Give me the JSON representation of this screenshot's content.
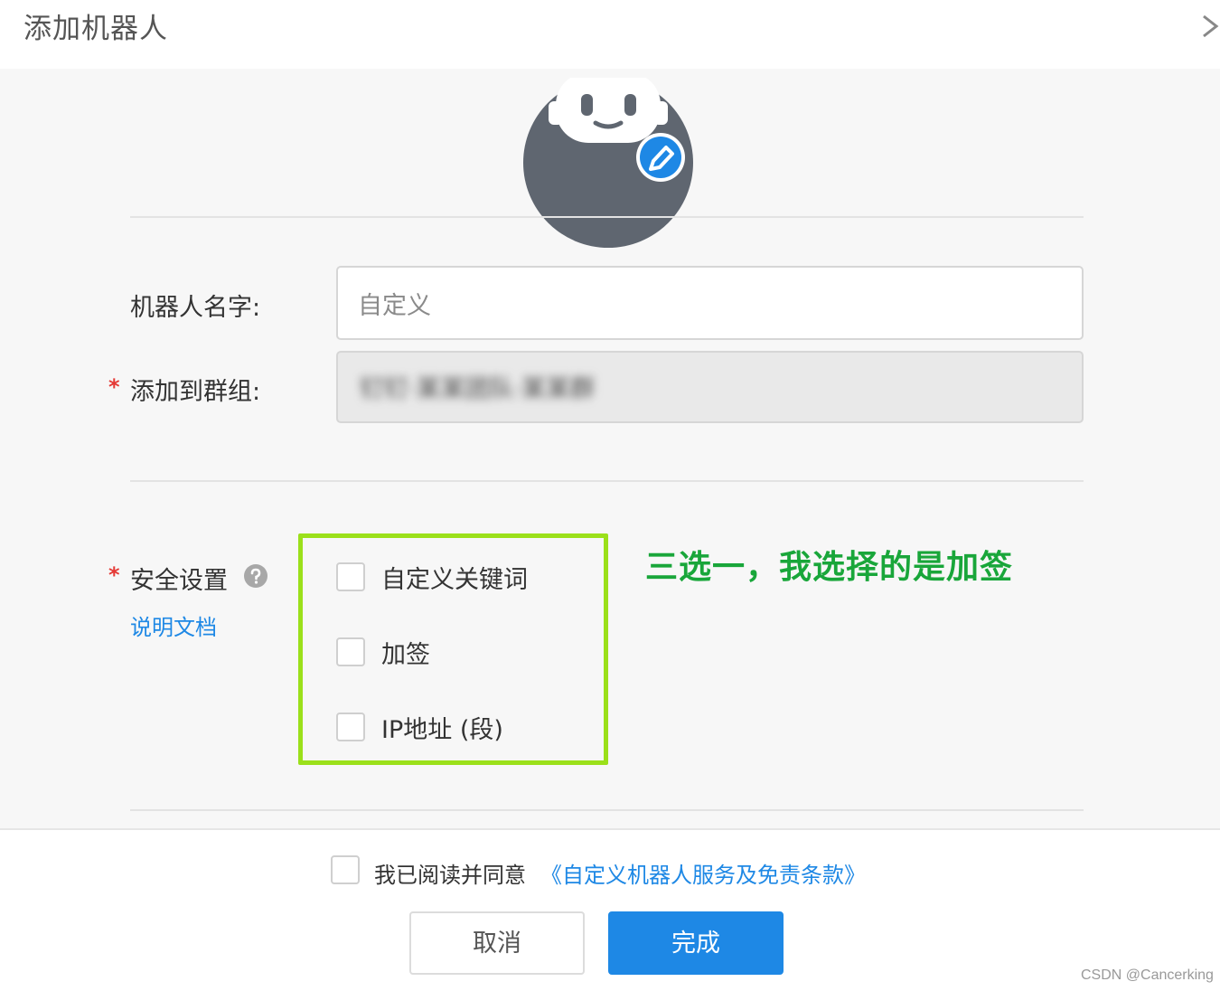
{
  "dialog": {
    "title": "添加机器人"
  },
  "form": {
    "name_label": "机器人名字:",
    "name_value": "自定义",
    "group_label": "添加到群组:",
    "group_value": "钉钉·某某团队·某某群",
    "required_mark": "*"
  },
  "security": {
    "label": "安全设置",
    "doc_link": "说明文档",
    "options": [
      {
        "label": "自定义关键词",
        "checked": false
      },
      {
        "label": "加签",
        "checked": false
      },
      {
        "label": "IP地址 (段)",
        "checked": false
      }
    ],
    "annotation": "三选一，我选择的是加签",
    "highlight_color": "#9be01a",
    "annotation_color": "#19a63a"
  },
  "footer": {
    "agree_checked": false,
    "agree_text": "我已阅读并同意",
    "agree_link": "《自定义机器人服务及免责条款》",
    "cancel_label": "取消",
    "done_label": "完成",
    "primary_color": "#1e88e5"
  },
  "watermark": "CSDN @Cancerking",
  "icons": {
    "close": "close-icon",
    "avatar": "robot-avatar-icon",
    "edit": "pencil-edit-icon",
    "help": "question-help-icon"
  }
}
